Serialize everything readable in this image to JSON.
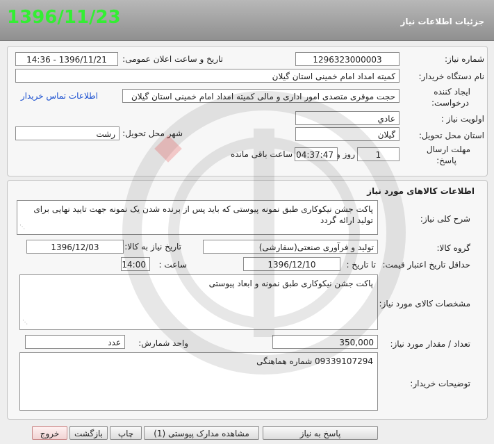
{
  "header": {
    "date": "1396/11/23",
    "title": "جزئیات اطلاعات نیاز"
  },
  "info": {
    "need_number_label": "شماره نیاز:",
    "need_number": "1296323000003",
    "announce_label": "تاریخ و ساعت اعلان عمومی:",
    "announce_value": "1396/11/21 - 14:36",
    "buyer_org_label": "نام دستگاه خریدار:",
    "buyer_org": "کمیته امداد امام خمینی استان گیلان",
    "creator_label_1": "ایجاد کننده",
    "creator_label_2": "درخواست:",
    "creator": "حجت موقری متصدی امور اداری و مالی کمیته امداد امام خمینی استان گیلان",
    "contact_link": "اطلاعات تماس خریدار",
    "priority_label": "اولویت نیاز :",
    "priority": "عادي",
    "province_label": "استان محل تحویل:",
    "province": "گیلان",
    "city_label": "شهر محل تحویل:",
    "city": "رشت",
    "deadline_label_1": "مهلت ارسال",
    "deadline_label_2": "پاسخ:",
    "days_value": "1",
    "days_label": "روز و",
    "time_value": "04:37:47",
    "remaining_label": "ساعت باقی مانده"
  },
  "goods": {
    "section_title": "اطلاعات کالاهای مورد نیاز",
    "desc_label": "شرح کلی نیاز:",
    "desc": "پاکت جشن نیکوکاری طبق نمونه پیوستی که باید پس از برنده شدن یک نمونه جهت تایید نهایی برای تولید ارائه گردد",
    "group_label": "گروه کالا:",
    "group": "تولید و فرآوری صنعتی(سفارشی)",
    "need_date_label": "تاریخ نیاز به کالا:",
    "need_date": "1396/12/03",
    "min_price_label": "حداقل تاریخ اعتبار قیمت:",
    "to_date_label": "تا تاریخ :",
    "to_date": "1396/12/10",
    "hour_label": "ساعت :",
    "hour": "14:00",
    "specs_label": "مشخصات کالای مورد نیاز:",
    "specs": "پاکت جشن نیکوکاری طبق نمونه و ابعاد پیوستی",
    "qty_label": "تعداد / مقدار مورد نیاز:",
    "qty": "350,000",
    "unit_label": "واحد شمارش:",
    "unit": "عدد",
    "buyer_notes_label": "توضیحات خریدار:",
    "buyer_notes": "09339107294 شماره هماهنگی"
  },
  "buttons": {
    "reply": "پاسخ به نیاز",
    "attachments": "مشاهده مدارک پیوستی (1)",
    "print": "چاپ",
    "back": "بازگشت",
    "exit": "خروج"
  }
}
